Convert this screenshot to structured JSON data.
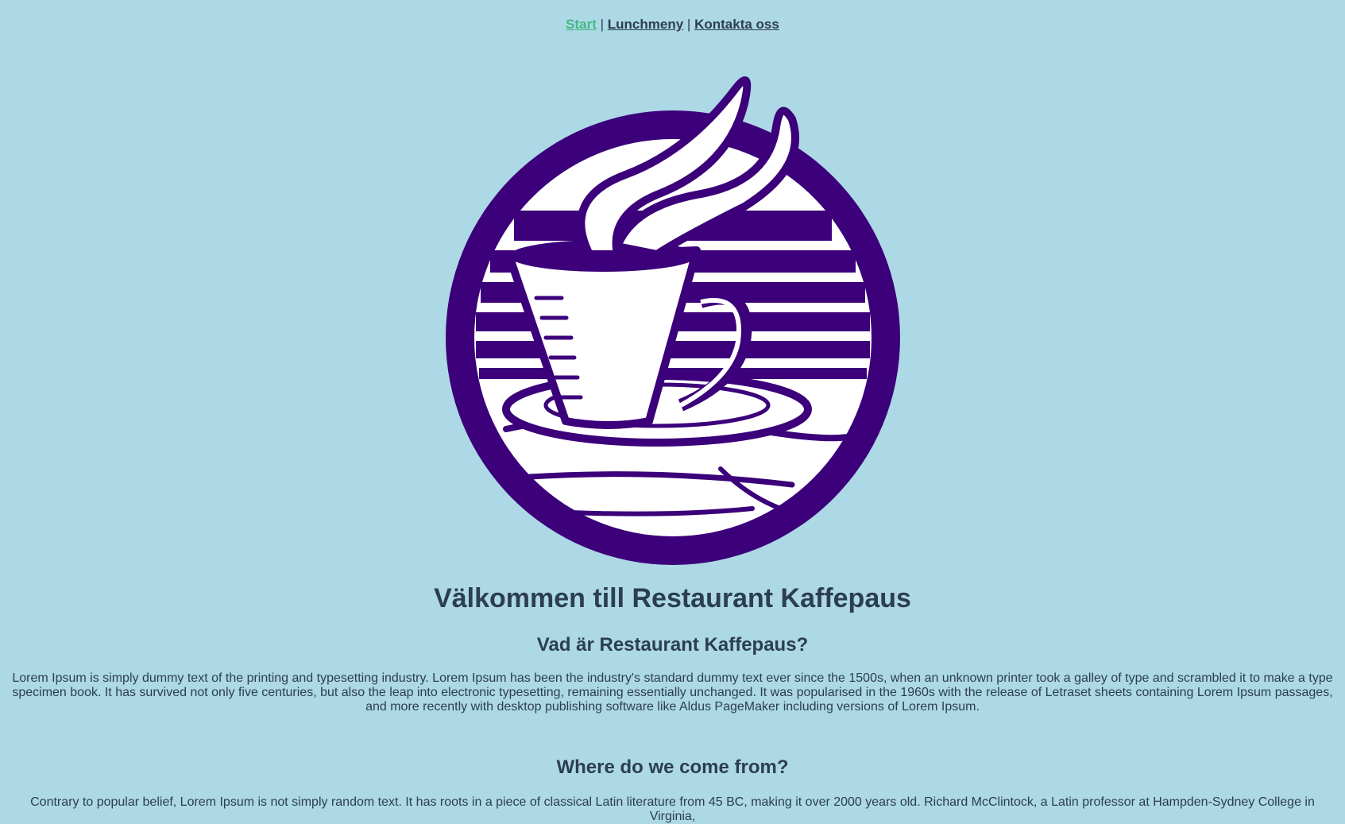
{
  "nav": {
    "items": [
      {
        "label": "Start",
        "active": true
      },
      {
        "label": "Lunchmeny",
        "active": false
      },
      {
        "label": "Kontakta oss",
        "active": false
      }
    ],
    "separator": "|"
  },
  "logo": {
    "icon": "coffee-cup-logo",
    "primary_color": "#3b007a",
    "background_color": "#add8e6"
  },
  "main": {
    "title": "Välkommen till Restaurant Kaffepaus",
    "section1": {
      "heading": "Vad är Restaurant Kaffepaus?",
      "text": "Lorem Ipsum is simply dummy text of the printing and typesetting industry. Lorem Ipsum has been the industry's standard dummy text ever since the 1500s, when an unknown printer took a galley of type and scrambled it to make a type specimen book. It has survived not only five centuries, but also the leap into electronic typesetting, remaining essentially unchanged. It was popularised in the 1960s with the release of Letraset sheets containing Lorem Ipsum passages, and more recently with desktop publishing software like Aldus PageMaker including versions of Lorem Ipsum."
    },
    "section2": {
      "heading": "Where do we come from?",
      "text": "Contrary to popular belief, Lorem Ipsum is not simply random text. It has roots in a piece of classical Latin literature from 45 BC, making it over 2000 years old. Richard McClintock, a Latin professor at Hampden-Sydney College in Virginia,"
    }
  },
  "colors": {
    "background": "#add8e6",
    "text": "#2c3e50",
    "active_link": "#42b983"
  }
}
